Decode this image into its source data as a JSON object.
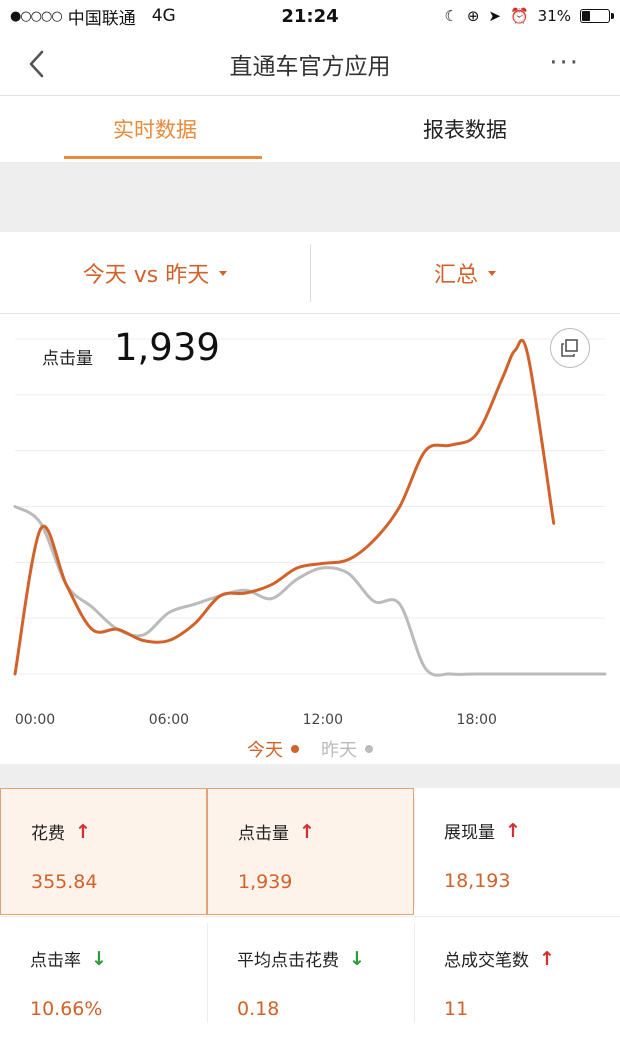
{
  "status_bar": {
    "signal": "●○○○○",
    "carrier": "中国联通",
    "network": "4G",
    "time": "21:24",
    "battery_percent": "31%",
    "battery_level": 0.31
  },
  "nav": {
    "title": "直通车官方应用",
    "more": "···"
  },
  "tabs": [
    {
      "label": "实时数据",
      "active": true
    },
    {
      "label": "报表数据",
      "active": false
    }
  ],
  "selectors": {
    "compare": "今天 vs 昨天",
    "scope": "汇总"
  },
  "chart": {
    "metric_label": "点击量",
    "metric_value": "1,939"
  },
  "chart_data": {
    "type": "line",
    "x_ticks": [
      "00:00",
      "06:00",
      "12:00",
      "18:00"
    ],
    "xlim": [
      0,
      23
    ],
    "ylim": [
      0,
      6
    ],
    "grid": true,
    "legend_position": "bottom-center",
    "series": [
      {
        "name": "今天",
        "color": "#d2612a",
        "points": [
          [
            0,
            0.0
          ],
          [
            1,
            2.6
          ],
          [
            2,
            1.6
          ],
          [
            3,
            0.8
          ],
          [
            4,
            0.8
          ],
          [
            5,
            0.6
          ],
          [
            6,
            0.6
          ],
          [
            7,
            0.9
          ],
          [
            8,
            1.4
          ],
          [
            9,
            1.45
          ],
          [
            10,
            1.6
          ],
          [
            11,
            1.9
          ],
          [
            12,
            1.98
          ],
          [
            13,
            2.05
          ],
          [
            14,
            2.4
          ],
          [
            15,
            3.0
          ],
          [
            16,
            4.0
          ],
          [
            17,
            4.1
          ],
          [
            18,
            4.3
          ],
          [
            19,
            5.3
          ],
          [
            19.5,
            5.8
          ],
          [
            20,
            5.7
          ],
          [
            21,
            2.7
          ]
        ]
      },
      {
        "name": "昨天",
        "color": "#bbbbbb",
        "points": [
          [
            0,
            3.0
          ],
          [
            1,
            2.7
          ],
          [
            2,
            1.6
          ],
          [
            3,
            1.2
          ],
          [
            4,
            0.8
          ],
          [
            5,
            0.7
          ],
          [
            6,
            1.1
          ],
          [
            7,
            1.25
          ],
          [
            8,
            1.4
          ],
          [
            9,
            1.5
          ],
          [
            10,
            1.35
          ],
          [
            11,
            1.7
          ],
          [
            12,
            1.9
          ],
          [
            13,
            1.8
          ],
          [
            14,
            1.3
          ],
          [
            15,
            1.25
          ],
          [
            16,
            0.1
          ],
          [
            17,
            0.0
          ],
          [
            18,
            0.0
          ],
          [
            20,
            0.0
          ],
          [
            23,
            0.0
          ]
        ]
      }
    ]
  },
  "legend": {
    "today": "今天",
    "yesterday": "昨天",
    "today_color": "#d2612a",
    "yesterday_color": "#bbbbbb"
  },
  "metrics": [
    {
      "name": "花费",
      "value": "355.84",
      "trend": "up",
      "selected": true
    },
    {
      "name": "点击量",
      "value": "1,939",
      "trend": "up",
      "selected": true
    },
    {
      "name": "展现量",
      "value": "18,193",
      "trend": "up",
      "selected": false
    },
    {
      "name": "点击率",
      "value": "10.66%",
      "trend": "down",
      "selected": false
    },
    {
      "name": "平均点击花费",
      "value": "0.18",
      "trend": "down",
      "selected": false
    },
    {
      "name": "总成交笔数",
      "value": "11",
      "trend": "up",
      "selected": false
    }
  ],
  "trend_symbols": {
    "up": "↑",
    "down": "↓"
  }
}
